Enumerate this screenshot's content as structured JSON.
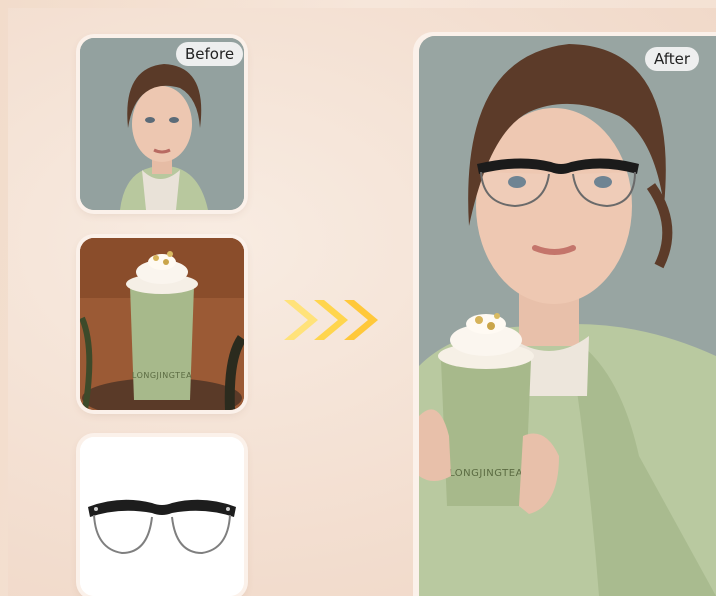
{
  "labels": {
    "before": "Before",
    "after": "After"
  },
  "cup_brand": "LONGJINGTEA",
  "colors": {
    "arrow": "#ffd24a",
    "jacket": "#b9c9a0",
    "cup": "#a7b98b",
    "background": "#f3e0d2"
  },
  "icons": {
    "arrows": "triple-chevron-right-icon"
  }
}
